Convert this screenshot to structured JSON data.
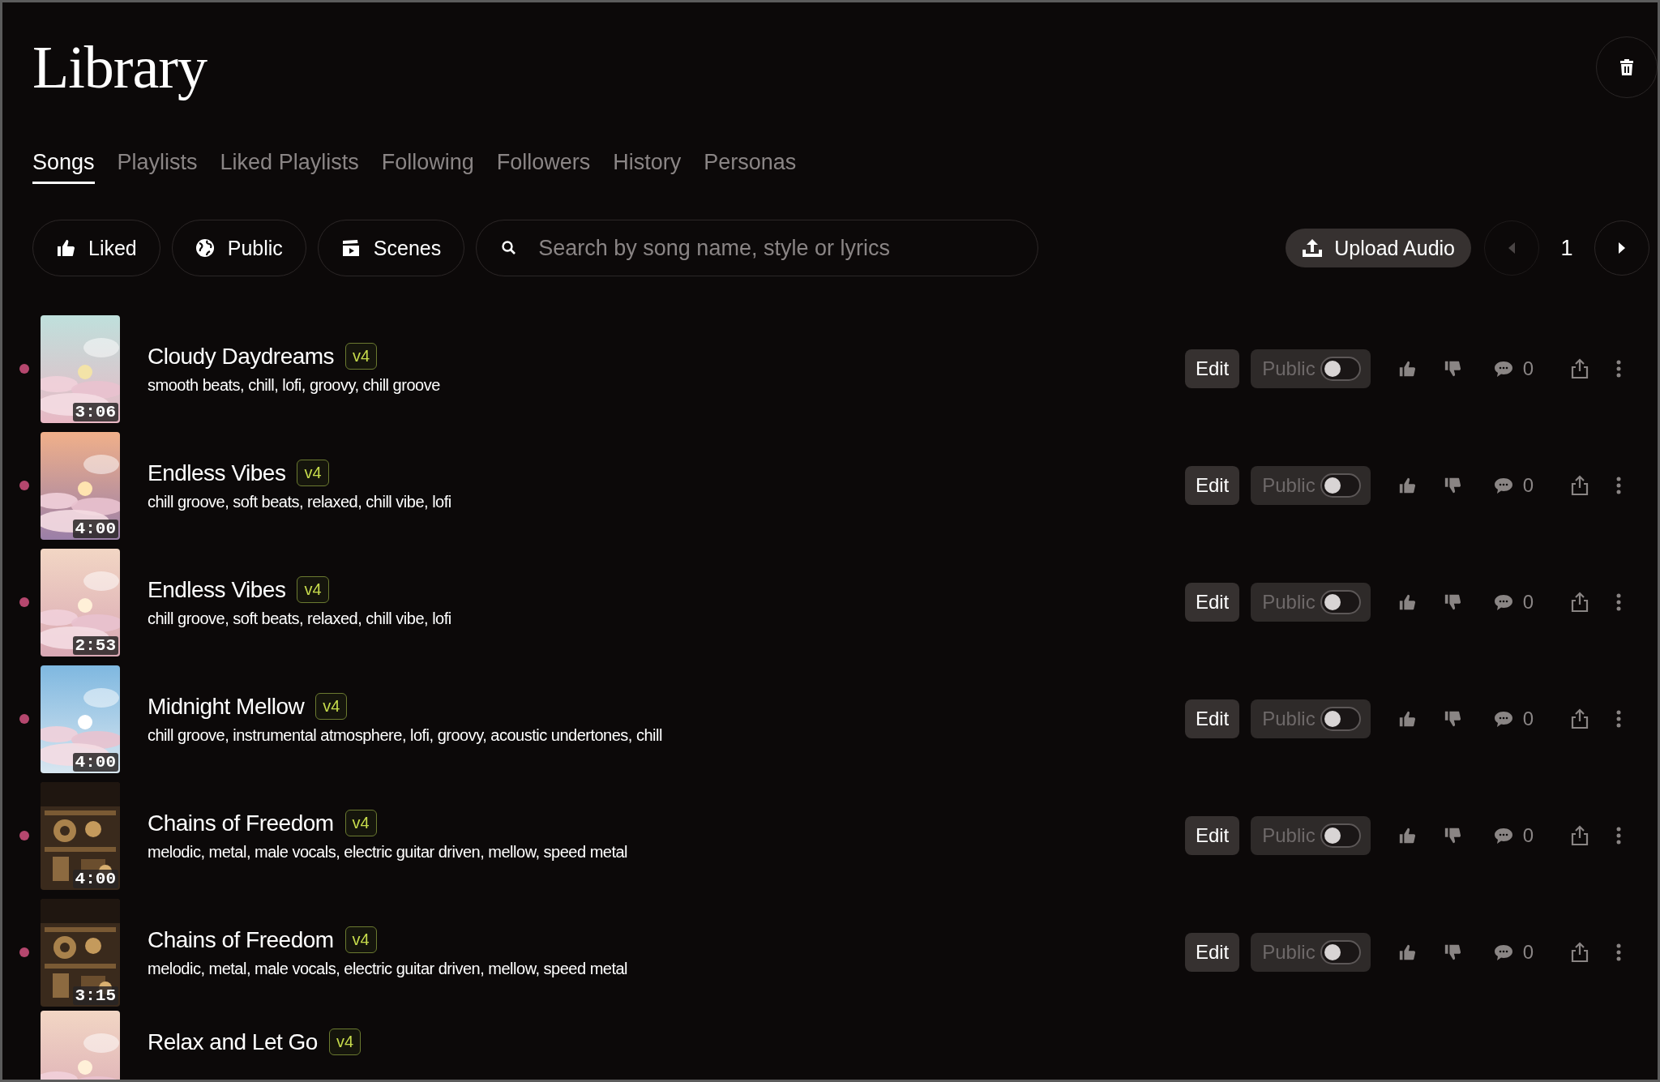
{
  "title": "Library",
  "tabs": [
    {
      "label": "Songs",
      "selected": true
    },
    {
      "label": "Playlists",
      "selected": false
    },
    {
      "label": "Liked Playlists",
      "selected": false
    },
    {
      "label": "Following",
      "selected": false
    },
    {
      "label": "Followers",
      "selected": false
    },
    {
      "label": "History",
      "selected": false
    },
    {
      "label": "Personas",
      "selected": false
    }
  ],
  "filters": [
    {
      "label": "Liked",
      "kind": "thumb"
    },
    {
      "label": "Public",
      "kind": "globe"
    },
    {
      "label": "Scenes",
      "kind": "clapper"
    }
  ],
  "search": {
    "placeholder": "Search by song name, style or lyrics"
  },
  "upload": {
    "label": "Upload Audio"
  },
  "pager": {
    "page": "1",
    "prev_disabled": true
  },
  "songs": [
    {
      "title": "Cloudy Daydreams",
      "version": "v4",
      "tags": "smooth beats, chill, lofi, groovy, chill groove",
      "duration": "3:06",
      "new": true,
      "edit": "Edit",
      "visibility": "Public",
      "public": false,
      "comments": "0"
    },
    {
      "title": "Endless Vibes",
      "version": "v4",
      "tags": "chill groove, soft beats, relaxed, chill vibe, lofi",
      "duration": "4:00",
      "new": true,
      "edit": "Edit",
      "visibility": "Public",
      "public": false,
      "comments": "0"
    },
    {
      "title": "Endless Vibes",
      "version": "v4",
      "tags": "chill groove, soft beats, relaxed, chill vibe, lofi",
      "duration": "2:53",
      "new": true,
      "edit": "Edit",
      "visibility": "Public",
      "public": false,
      "comments": "0"
    },
    {
      "title": "Midnight Mellow",
      "version": "v4",
      "tags": "chill groove, instrumental atmosphere, lofi, groovy, acoustic undertones, chill",
      "duration": "4:00",
      "new": true,
      "edit": "Edit",
      "visibility": "Public",
      "public": false,
      "comments": "0"
    },
    {
      "title": "Chains of Freedom",
      "version": "v4",
      "tags": "melodic, metal, male vocals, electric guitar driven, mellow, speed metal",
      "duration": "4:00",
      "new": true,
      "edit": "Edit",
      "visibility": "Public",
      "public": false,
      "comments": "0"
    },
    {
      "title": "Chains of Freedom",
      "version": "v4",
      "tags": "melodic, metal, male vocals, electric guitar driven, mellow, speed metal",
      "duration": "3:15",
      "new": true,
      "edit": "Edit",
      "visibility": "Public",
      "public": false,
      "comments": "0"
    },
    {
      "title": "Relax and Let Go",
      "version": "v4"
    }
  ]
}
